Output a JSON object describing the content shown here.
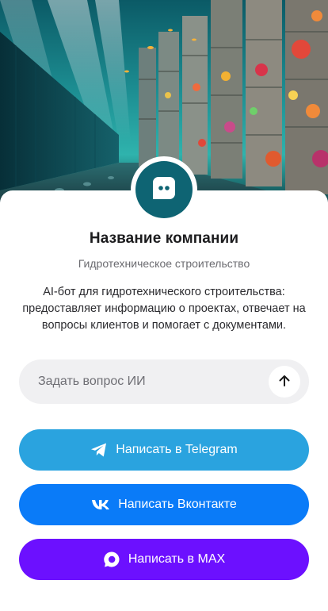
{
  "company": {
    "name": "Название компании",
    "subtitle": "Гидротехническое строительство",
    "description": "AI-бот для гидротехнического строительства: предоставляет информацию о проектах, отвечает на вопросы клиентов и помогает с документами."
  },
  "ask": {
    "placeholder": "Задать вопрос ИИ",
    "value": "",
    "send_icon": "arrow-up-icon"
  },
  "buttons": [
    {
      "label": "Написать в Telegram",
      "icon": "telegram-icon",
      "color": "#2aa3df"
    },
    {
      "label": "Написать Вконтакте",
      "icon": "vk-icon",
      "color": "#0a7bf8"
    },
    {
      "label": "Написать в MAX",
      "icon": "max-icon",
      "color": "#6c10ff"
    }
  ],
  "avatar": {
    "icon": "chat-bot-icon",
    "color": "#0e6473"
  }
}
